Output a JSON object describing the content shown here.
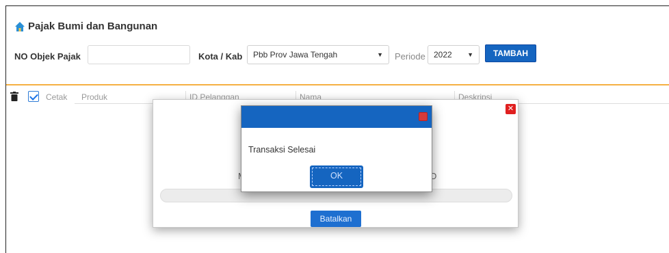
{
  "page": {
    "title": "Pajak Bumi dan Bangunan"
  },
  "filters": {
    "objek_label": "NO Objek Pajak",
    "objek_value": "",
    "kota_label": "Kota / Kab",
    "kota_value": "Pbb Prov Jawa Tengah",
    "periode_label": "Periode",
    "periode_value": "2022",
    "add_button": "TAMBAH"
  },
  "table": {
    "columns": [
      "Cetak",
      "Produk",
      "ID Pelanggan",
      "Nama",
      "Deskripsi"
    ]
  },
  "progress_dialog": {
    "fragment_left": "M",
    "fragment_right": "D",
    "progress_fraction": 0,
    "cancel_button": "Batalkan"
  },
  "alert_dialog": {
    "message": "Transaksi Selesai",
    "ok_button": "OK"
  },
  "colors": {
    "primary": "#1565c0",
    "accent_line": "#f5b041",
    "close_red": "#e02020"
  }
}
